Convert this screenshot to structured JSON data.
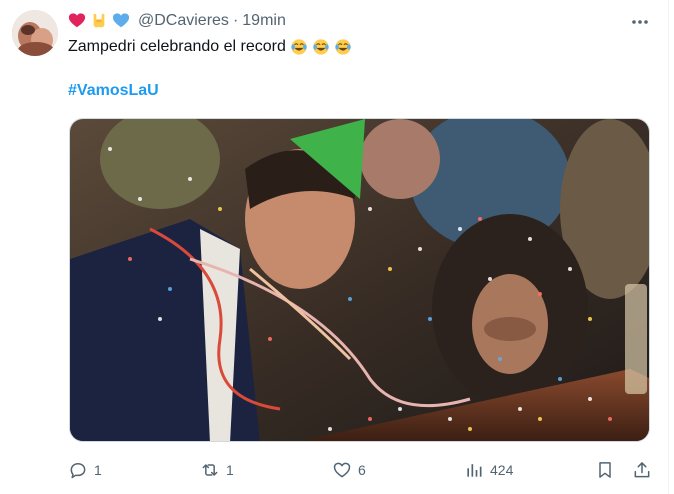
{
  "tweet": {
    "handle": "@DCavieres",
    "separator": "·",
    "time": "19min",
    "text": "Zampedri celebrando el record",
    "hashtag": "#VamosLaU",
    "header_emojis": [
      "red-heart",
      "sign-of-the-horns",
      "blue-heart"
    ],
    "text_emojis": [
      "face-with-tears-of-joy",
      "face-with-tears-of-joy",
      "face-with-tears-of-joy"
    ],
    "media_description_icon": "party-scene-image"
  },
  "actions": {
    "reply_count": "1",
    "retweet_count": "1",
    "like_count": "6",
    "views_count": "424"
  },
  "colors": {
    "accent": "#1d9bf0",
    "muted": "#536471",
    "text": "#0f1419",
    "border": "#cfd9de"
  }
}
